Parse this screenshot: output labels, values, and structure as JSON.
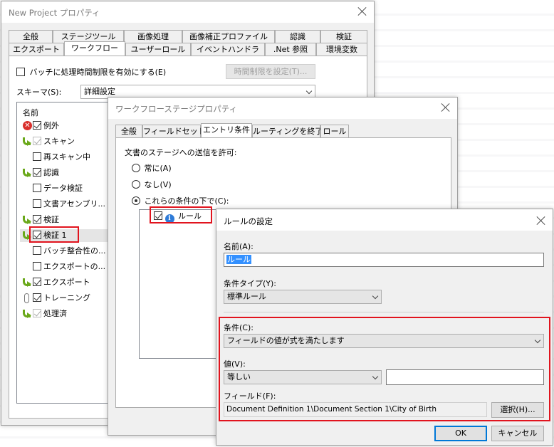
{
  "background_color": "#f6f6f8",
  "project_dialog": {
    "title": "New Project プロパティ",
    "tabs_row1": [
      "全般",
      "ステージツール",
      "画像処理",
      "画像補正プロファイル",
      "認識",
      "検証"
    ],
    "tabs_row2": [
      "エクスポート",
      "ワークフロー",
      "ユーザーロール",
      "イベントハンドラ",
      ".Net 参照",
      "環境変数"
    ],
    "active_tab": "ワークフロー",
    "batch_time_limit_label": "バッチに処理時間制限を有効にする(E)",
    "set_time_limit_button": "時間制限を設定(T)...",
    "schema_label": "スキーマ(S):",
    "schema_value": "詳細設定",
    "list_header": "名前",
    "stages": [
      {
        "name": "例外",
        "icon": "error-icon",
        "checked": true
      },
      {
        "name": "スキャン",
        "icon": "arrow-icon",
        "checked": true,
        "dim": true
      },
      {
        "name": "再スキャン中",
        "icon": "none",
        "checked": false
      },
      {
        "name": "認識",
        "icon": "arrow-icon",
        "checked": true
      },
      {
        "name": "データ検証",
        "icon": "none",
        "checked": false
      },
      {
        "name": "文書アセンブリ...",
        "icon": "none",
        "checked": false
      },
      {
        "name": "検証",
        "icon": "arrow-icon",
        "checked": true
      },
      {
        "name": "検証 1",
        "icon": "arrow-icon",
        "checked": true,
        "selected": true
      },
      {
        "name": "バッチ整合性の...",
        "icon": "none",
        "checked": false
      },
      {
        "name": "エクスポートの...",
        "icon": "none",
        "checked": false
      },
      {
        "name": "エクスポート",
        "icon": "arrow-icon",
        "checked": true
      },
      {
        "name": "トレーニング",
        "icon": "clip-icon",
        "checked": true
      },
      {
        "name": "処理済",
        "icon": "arrow-icon",
        "checked": true,
        "dim": true
      }
    ]
  },
  "stage_dialog": {
    "title": "ワークフローステージプロパティ",
    "tabs": [
      "全般",
      "フィールドセット",
      "エントリ条件",
      "ルーティングを終了",
      "ロール"
    ],
    "active_tab": "エントリ条件",
    "allow_label": "文書のステージへの送信を許可:",
    "options": [
      "常に(A)",
      "なし(V)",
      "これらの条件の下で(C):"
    ],
    "selected_option": 2,
    "rule_item": "ルール"
  },
  "rule_dialog": {
    "title": "ルールの設定",
    "name_label": "名前(A):",
    "name_value": "ルール",
    "condition_type_label": "条件タイプ(Y):",
    "condition_type_value": "標準ルール",
    "condition_label": "条件(C):",
    "condition_value": "フィールドの値が式を満たします",
    "value_label": "値(V):",
    "value_operator": "等しい",
    "value_input": "",
    "field_label": "フィールド(F):",
    "field_value": "Document Definition 1\\Document Section 1\\City of Birth",
    "select_button": "選択(H)...",
    "ok_button": "OK",
    "cancel_button": "キャンセル"
  },
  "highlight_color": "#e1141e",
  "accent_color": "#0078d7"
}
